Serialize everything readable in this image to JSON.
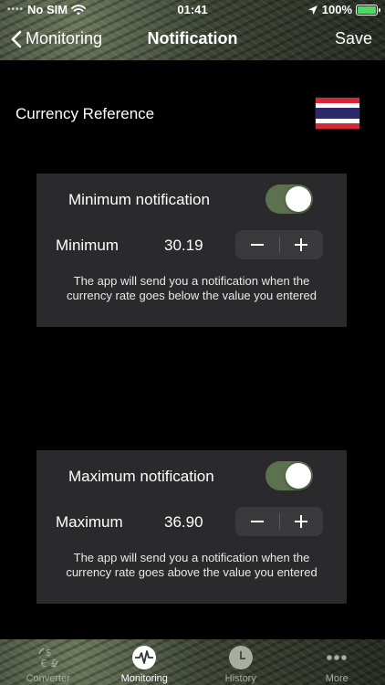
{
  "status_bar": {
    "carrier": "No SIM",
    "time": "01:41",
    "battery": "100%",
    "battery_level": 1.0
  },
  "nav": {
    "back_label": "Monitoring",
    "title": "Notification",
    "save_label": "Save"
  },
  "currency_reference": {
    "label": "Currency Reference",
    "flag_icon": "thailand-flag-icon"
  },
  "min_card": {
    "toggle_label": "Minimum notification",
    "toggle_on": true,
    "value_label": "Minimum",
    "value": "30.19",
    "description": "The app will send you a notification when the currency rate goes below the value you entered"
  },
  "max_card": {
    "toggle_label": "Maximum notification",
    "toggle_on": true,
    "value_label": "Maximum",
    "value": "36.90",
    "description": "The app will send you a notification when the currency rate goes above the value you entered"
  },
  "tabs": [
    {
      "label": "Converter",
      "icon": "currency-exchange-icon",
      "active": false
    },
    {
      "label": "Monitoring",
      "icon": "heartbeat-icon",
      "active": true
    },
    {
      "label": "History",
      "icon": "clock-icon",
      "active": false
    },
    {
      "label": "More",
      "icon": "ellipsis-icon",
      "active": false
    }
  ],
  "colors": {
    "card_bg": "#2a2a2c",
    "toggle_on": "#5c7150",
    "battery_green": "#4cd964",
    "flag_red": "#d2283a",
    "flag_blue": "#2d2a6a"
  }
}
